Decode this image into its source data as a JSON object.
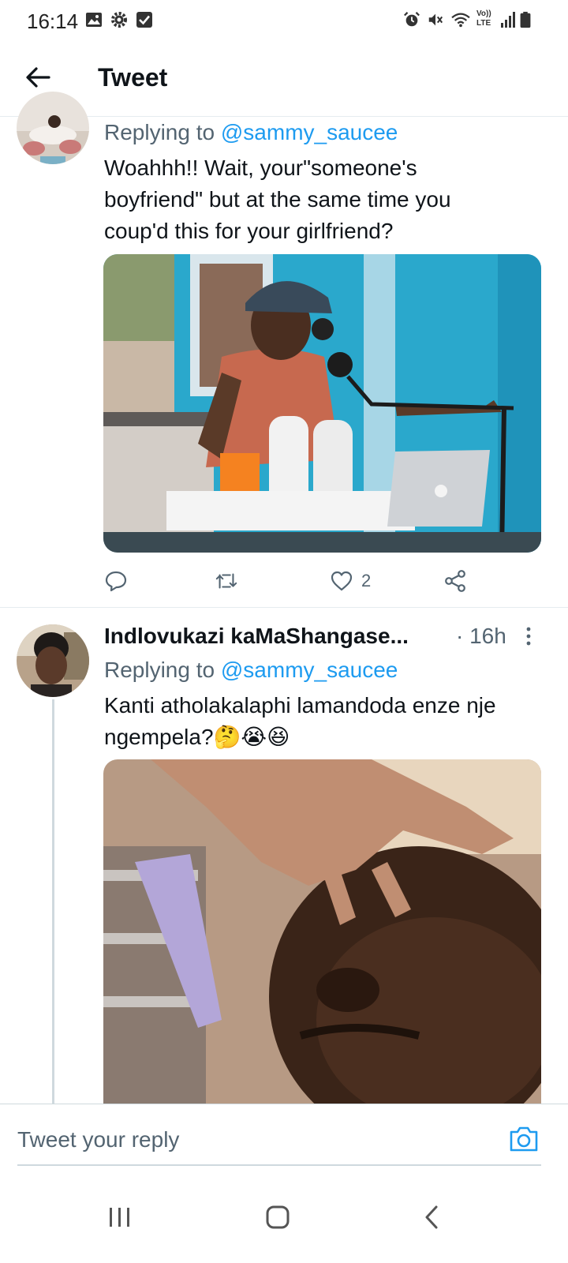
{
  "status_bar": {
    "time": "16:14",
    "left_icons": [
      "gallery-icon",
      "gear-icon",
      "checkbox-icon"
    ],
    "right_icons": [
      "alarm-icon",
      "mute-icon",
      "wifi-icon",
      "volte-icon",
      "signal-icon",
      "battery-icon"
    ],
    "volte_label": "Vo)) LTE"
  },
  "header": {
    "title": "Tweet",
    "back_icon": "arrow-left-icon"
  },
  "tweet1": {
    "replying_prefix": "Replying to ",
    "replying_handle": "@sammy_saucee",
    "text_line1": "Woahhh!! Wait, your\"someone's",
    "text_line2": "boyfriend\" but at the same time you",
    "text_line3": "coup'd this for your girlfriend?",
    "actions": {
      "reply_icon": "comment-icon",
      "retweet_icon": "retweet-icon",
      "like_icon": "heart-icon",
      "like_count": "2",
      "share_icon": "share-icon"
    }
  },
  "tweet2": {
    "author": "Indlovukazi kaMaShangase...",
    "time": "· 16h",
    "replying_prefix": "Replying to ",
    "replying_handle": "@sammy_saucee",
    "text_line1": "Kanti atholakalaphi lamandoda enze nje",
    "text_line2": "ngempela?",
    "emojis": "🤔😭😆"
  },
  "reply_bar": {
    "placeholder": "Tweet your reply",
    "camera_icon": "camera-icon"
  },
  "nav_bar": {
    "icons": [
      "recents-icon",
      "home-icon",
      "back-icon"
    ]
  },
  "colors": {
    "accent": "#1d9bf0",
    "secondary_text": "#536471",
    "divider": "#e6ecf0"
  }
}
